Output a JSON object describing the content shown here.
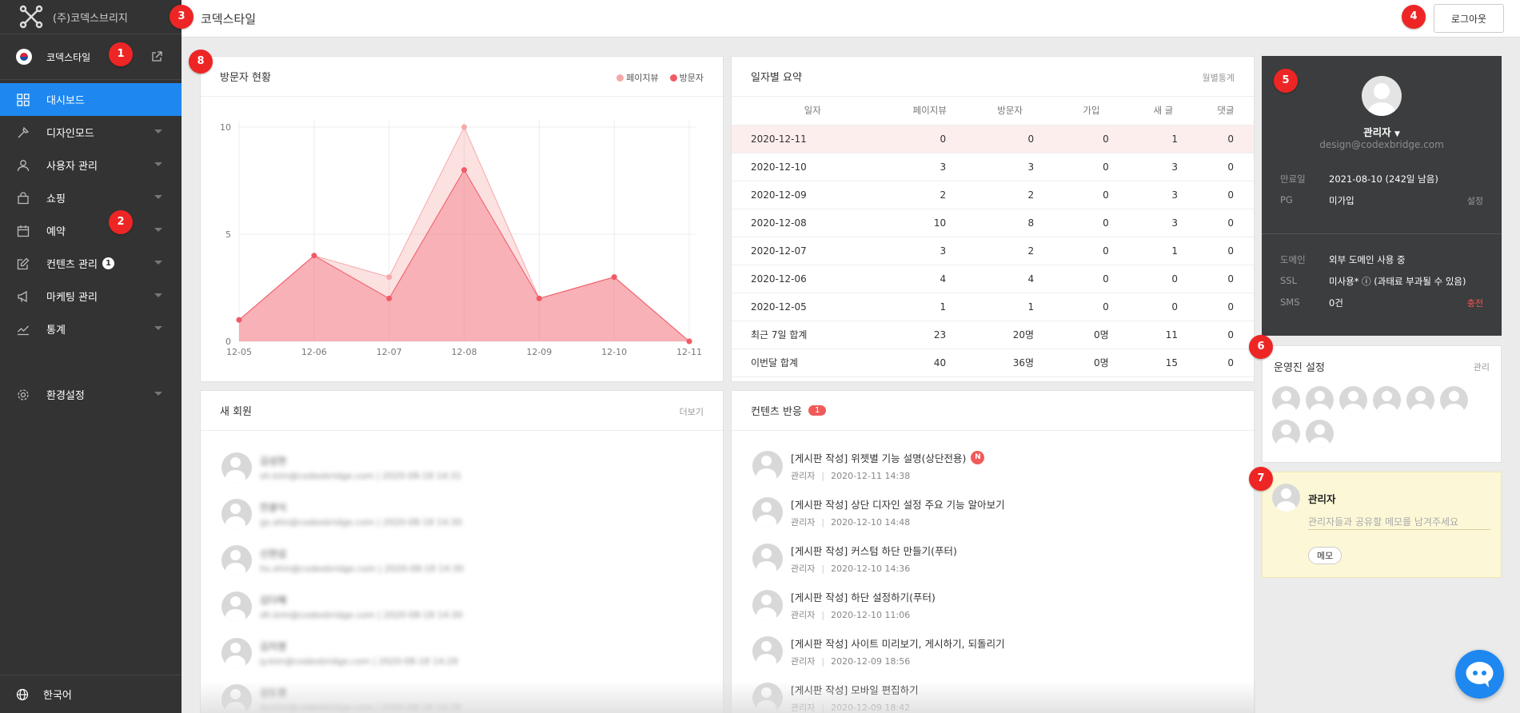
{
  "sidebar": {
    "company": "(주)코덱스브리지",
    "site_name": "코덱스타일",
    "items": [
      {
        "label": "대시보드",
        "icon": "dashboard-icon",
        "active": true
      },
      {
        "label": "디자인모드",
        "icon": "design-icon"
      },
      {
        "label": "사용자 관리",
        "icon": "user-icon"
      },
      {
        "label": "쇼핑",
        "icon": "shopping-bag-icon"
      },
      {
        "label": "예약",
        "icon": "calendar-icon"
      },
      {
        "label": "컨텐츠 관리",
        "icon": "edit-icon",
        "count": "1"
      },
      {
        "label": "마케팅 관리",
        "icon": "megaphone-icon"
      },
      {
        "label": "통계",
        "icon": "stats-icon"
      },
      {
        "label": "환경설정",
        "icon": "settings-icon"
      }
    ],
    "language": "한국어"
  },
  "header": {
    "title": "코덱스타일",
    "logout": "로그아웃"
  },
  "visitors": {
    "title": "방문자 현황",
    "legend": [
      "페이지뷰",
      "방문자"
    ]
  },
  "chart_data": {
    "type": "area",
    "x": [
      "12-05",
      "12-06",
      "12-07",
      "12-08",
      "12-09",
      "12-10",
      "12-11"
    ],
    "series": [
      {
        "name": "페이지뷰",
        "values": [
          1,
          4,
          3,
          10,
          2,
          3,
          0
        ],
        "color": "#f7a8aa"
      },
      {
        "name": "방문자",
        "values": [
          1,
          4,
          2,
          8,
          2,
          3,
          0
        ],
        "color": "#f05a66"
      }
    ],
    "yticks": [
      0,
      5,
      10
    ],
    "ylim": [
      0,
      10
    ],
    "grid": true,
    "legend_position": "top-right"
  },
  "daily": {
    "title": "일자별 요약",
    "link": "월별통계",
    "columns": [
      "일자",
      "페이지뷰",
      "방문자",
      "가입",
      "새 글",
      "댓글"
    ],
    "rows": [
      [
        "2020-12-11",
        "0",
        "0",
        "0",
        "1",
        "0"
      ],
      [
        "2020-12-10",
        "3",
        "3",
        "0",
        "3",
        "0"
      ],
      [
        "2020-12-09",
        "2",
        "2",
        "0",
        "3",
        "0"
      ],
      [
        "2020-12-08",
        "10",
        "8",
        "0",
        "3",
        "0"
      ],
      [
        "2020-12-07",
        "3",
        "2",
        "0",
        "1",
        "0"
      ],
      [
        "2020-12-06",
        "4",
        "4",
        "0",
        "0",
        "0"
      ],
      [
        "2020-12-05",
        "1",
        "1",
        "0",
        "0",
        "0"
      ],
      [
        "최근 7일 합계",
        "23",
        "20명",
        "0명",
        "11",
        "0"
      ],
      [
        "이번달 합계",
        "40",
        "36명",
        "0명",
        "15",
        "0"
      ]
    ]
  },
  "profile": {
    "name": "관리자",
    "email": "design@codexbridge.com",
    "expiry_label": "만료일",
    "expiry_value": "2021-08-10 (242일 남음)",
    "pg_label": "PG",
    "pg_value": "미가입",
    "pg_action": "설정",
    "domain_label": "도메인",
    "domain_value": "외부 도메인 사용 중",
    "ssl_label": "SSL",
    "ssl_value": "미사용* ⓘ (과태료 부과될 수 있음)",
    "sms_label": "SMS",
    "sms_value": "0건",
    "sms_action": "충전"
  },
  "operators": {
    "title": "운영진 설정",
    "link": "관리"
  },
  "memo": {
    "name": "관리자",
    "placeholder": "관리자들과 공유할 메모를 남겨주세요",
    "button": "메모"
  },
  "members": {
    "title": "새 회원",
    "link": "더보기",
    "items": [
      {
        "name": "김성현",
        "meta": "sh.kim@codexbridge.com  |  2020-08-18 14:31"
      },
      {
        "name": "안광식",
        "meta": "gs.ahn@codexbridge.com  |  2020-08-18 14:30"
      },
      {
        "name": "신현섭",
        "meta": "hs.shin@codexbridge.com  |  2020-08-18 14:30"
      },
      {
        "name": "김다혜",
        "meta": "dh.kim@codexbridge.com  |  2020-08-18 14:30"
      },
      {
        "name": "김지영",
        "meta": "jy.kim@codexbridge.com  |  2020-08-18 14:29"
      },
      {
        "name": "김도영",
        "meta": "dy.kim@codexbridge.com  |  2020-08-18 14:28"
      }
    ]
  },
  "reactions": {
    "title": "컨텐츠 반응",
    "count": "1",
    "new_badge": "N",
    "items": [
      {
        "title": "[게시판 작성] 위젯별 기능 설명(상단전용)",
        "author": "관리자",
        "date": "2020-12-11 14:38",
        "is_new": true
      },
      {
        "title": "[게시판 작성] 상단 디자인 설정 주요 기능 알아보기",
        "author": "관리자",
        "date": "2020-12-10 14:48"
      },
      {
        "title": "[게시판 작성] 커스텀 하단 만들기(푸터)",
        "author": "관리자",
        "date": "2020-12-10 14:36"
      },
      {
        "title": "[게시판 작성] 하단 설정하기(푸터)",
        "author": "관리자",
        "date": "2020-12-10 11:06"
      },
      {
        "title": "[게시판 작성] 사이트 미리보기, 게시하기, 되돌리기",
        "author": "관리자",
        "date": "2020-12-09 18:56"
      },
      {
        "title": "[게시판 작성] 모바일 편집하기",
        "author": "관리자",
        "date": "2020-12-09 18:42"
      }
    ]
  },
  "markers": [
    "1",
    "2",
    "3",
    "4",
    "5",
    "6",
    "7",
    "8"
  ]
}
